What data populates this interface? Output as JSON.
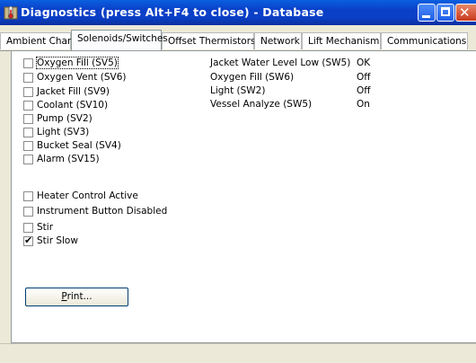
{
  "window": {
    "title": "Diagnostics  (press Alt+F4 to close) - Database",
    "icon": "thermometer-app-icon"
  },
  "tabs": [
    {
      "label": "Ambient Chart",
      "active": false
    },
    {
      "label": "Solenoids/Switches",
      "active": true
    },
    {
      "label": "Offset Thermistors",
      "active": false
    },
    {
      "label": "Network",
      "active": false
    },
    {
      "label": "Lift Mechanism",
      "active": false
    },
    {
      "label": "Communications",
      "active": false
    }
  ],
  "solenoids": [
    {
      "label": "Oxygen Fill (SV5)",
      "checked": false
    },
    {
      "label": "Oxygen Vent (SV6)",
      "checked": false
    },
    {
      "label": "Jacket Fill (SV9)",
      "checked": false
    },
    {
      "label": "Coolant (SV10)",
      "checked": false
    },
    {
      "label": "Pump (SV2)",
      "checked": false
    },
    {
      "label": "Light (SV3)",
      "checked": false
    },
    {
      "label": "Bucket Seal (SV4)",
      "checked": false
    },
    {
      "label": "Alarm (SV15)",
      "checked": false
    }
  ],
  "controls": [
    {
      "label": "Heater Control Active",
      "checked": false
    },
    {
      "label": "Instrument Button Disabled",
      "checked": false
    },
    {
      "label": "Stir",
      "checked": false
    },
    {
      "label": "Stir Slow",
      "checked": true
    }
  ],
  "switch_status": [
    {
      "name": "Jacket Water Level Low (SW5)",
      "value": "OK"
    },
    {
      "name": "Oxygen Fill (SW6)",
      "value": "Off"
    },
    {
      "name": "Light (SW2)",
      "value": "Off"
    },
    {
      "name": "Vessel Analyze (SW5)",
      "value": "On"
    }
  ],
  "print_button": {
    "label_hotkey": "P",
    "label_rest": "rint..."
  },
  "colors": {
    "titlebar": "#0a3fc7",
    "close_button": "#c8391c",
    "window_bg": "#ece9d8"
  }
}
